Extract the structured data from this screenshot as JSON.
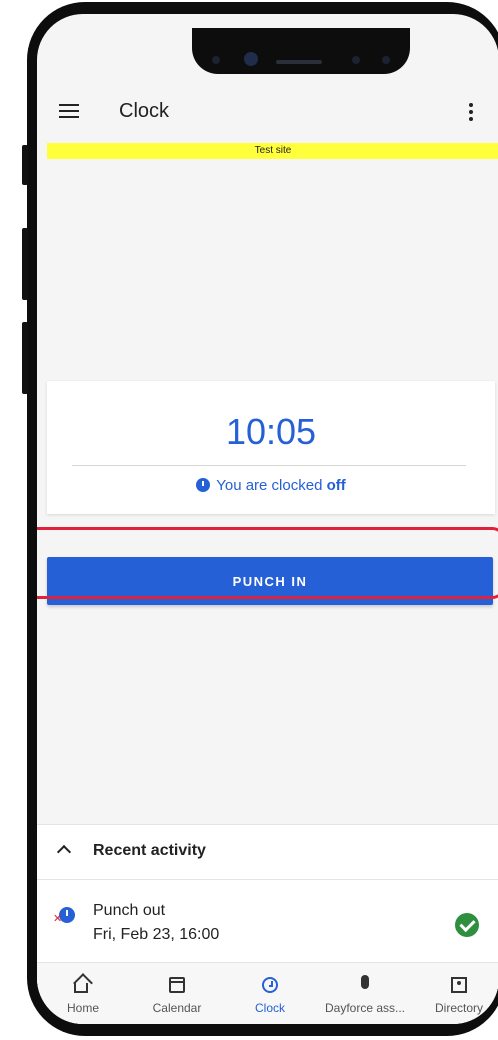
{
  "app_bar": {
    "title": "Clock"
  },
  "banner": {
    "text": "Test site"
  },
  "clock": {
    "time": "10:05",
    "status_prefix": "You are clocked ",
    "status_value": "off"
  },
  "punch_button": {
    "label": "PUNCH IN"
  },
  "recent_activity": {
    "title": "Recent activity",
    "items": [
      {
        "title": "Punch out",
        "subtitle": "Fri, Feb 23, 16:00",
        "status": "success"
      }
    ]
  },
  "bottom_nav": {
    "items": [
      {
        "label": "Home",
        "icon": "home-icon"
      },
      {
        "label": "Calendar",
        "icon": "calendar-icon"
      },
      {
        "label": "Clock",
        "icon": "clock-icon",
        "active": true
      },
      {
        "label": "Dayforce ass...",
        "icon": "microphone-icon"
      },
      {
        "label": "Directory",
        "icon": "directory-icon"
      }
    ]
  },
  "colors": {
    "accent": "#2660d6",
    "banner": "#ffff3c",
    "highlight": "#e0213b",
    "success": "#2f8f3e"
  }
}
